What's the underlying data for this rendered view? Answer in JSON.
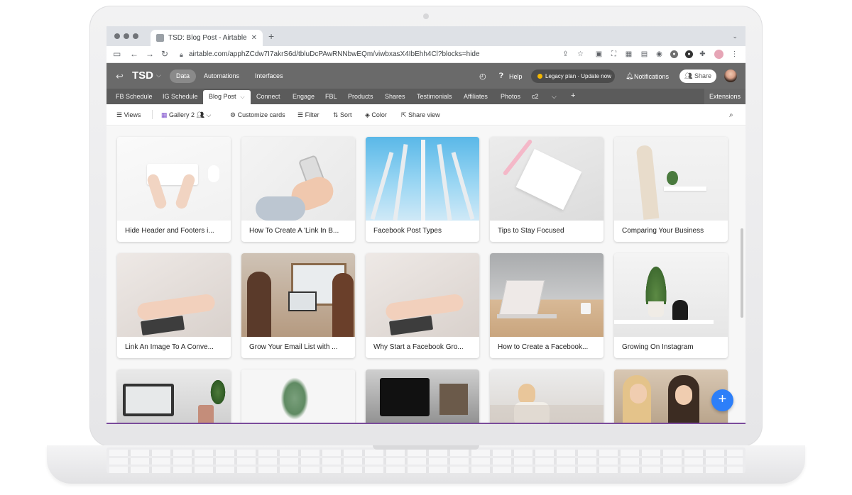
{
  "browser": {
    "tab_title": "TSD: Blog Post - Airtable",
    "new_tab": "+",
    "tab_menu": "⌄",
    "url": "airtable.com/apphZCdw7I7akrS6d/tbluDcPAwRNNbwEQm/viwbxasX4IbEhh4Cl?blocks=hide"
  },
  "airtable": {
    "base_name": "TSD",
    "nav": {
      "data": "Data",
      "automations": "Automations",
      "interfaces": "Interfaces"
    },
    "help": "Help",
    "legacy_plan": "Legacy plan · Update now",
    "notifications": "Notifications",
    "share": "Share",
    "tables": [
      "FB Schedule",
      "IG Schedule",
      "Blog Post",
      "Connect",
      "Engage",
      "FBL",
      "Products",
      "Shares",
      "Testimonials",
      "Affiliates",
      "Photos",
      "c2"
    ],
    "add_table": "+",
    "extensions": "Extensions"
  },
  "viewbar": {
    "views": "Views",
    "view_name": "Gallery 2",
    "customize": "Customize cards",
    "filter": "Filter",
    "sort": "Sort",
    "color": "Color",
    "share_view": "Share view"
  },
  "cards": [
    "Hide Header and Footers i...",
    "How To Create A 'Link In B...",
    "Facebook Post Types",
    "Tips to Stay Focused",
    "Comparing Your Business",
    "Link An Image To A Conve...",
    "Grow Your Email List with ...",
    "Why Start a Facebook Gro...",
    "How to Create a Facebook...",
    "Growing On Instagram"
  ],
  "icons": {
    "back": "arrow-left-icon",
    "forward": "arrow-right-icon",
    "reload": "reload-icon",
    "lock": "lock-icon",
    "history": "history-icon",
    "help": "help-icon",
    "bell": "bell-icon",
    "search": "search-icon",
    "add_record": "plus-icon"
  },
  "colors": {
    "header": "#6a6a6a",
    "tablebar": "#5b5b5b",
    "accent": "#2d7ff9",
    "legacy_dot": "#f5b800"
  }
}
